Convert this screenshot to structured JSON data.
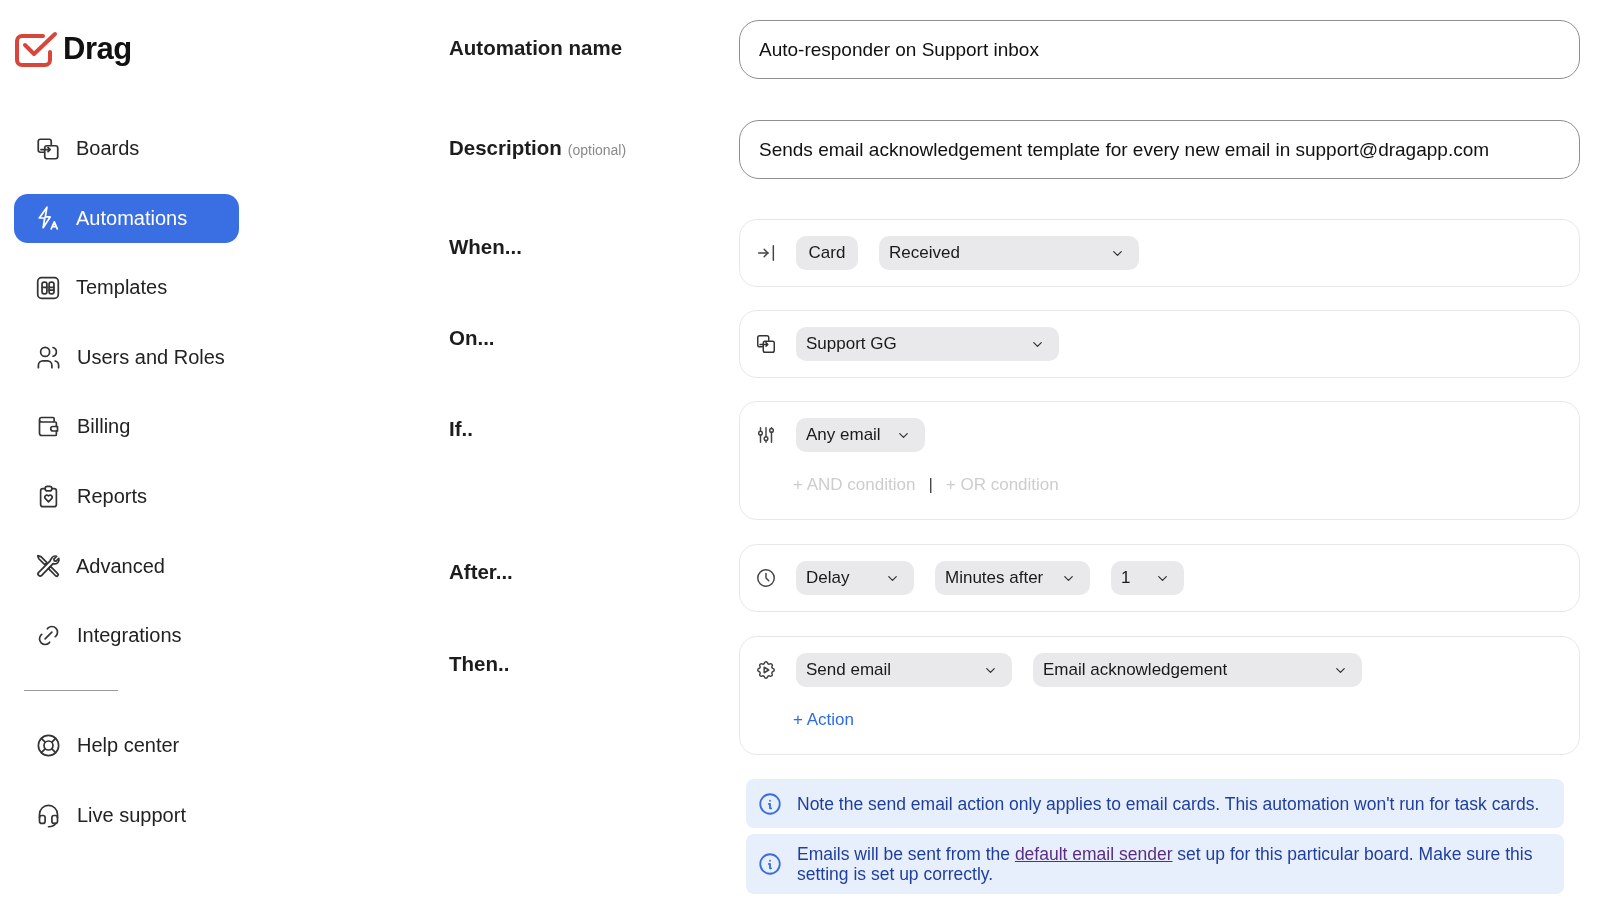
{
  "logo": {
    "text": "Drag"
  },
  "sidebar": {
    "items": [
      {
        "label": "Boards",
        "selected": false
      },
      {
        "label": "Automations",
        "selected": true
      },
      {
        "label": "Templates",
        "selected": false
      },
      {
        "label": "Users and Roles",
        "selected": false
      },
      {
        "label": "Billing",
        "selected": false
      },
      {
        "label": "Reports",
        "selected": false
      },
      {
        "label": "Advanced",
        "selected": false
      },
      {
        "label": "Integrations",
        "selected": false
      }
    ],
    "footer_items": [
      {
        "label": "Help center",
        "selected": false
      },
      {
        "label": "Live support",
        "selected": false
      }
    ]
  },
  "form": {
    "fields": [
      {
        "label": "Automation name",
        "value": "Auto-responder on Support inbox"
      },
      {
        "label": "Description",
        "hint": "(optional)",
        "value": "Sends email acknowledgement template for every new email in support@dragapp.com"
      }
    ],
    "steps": [
      {
        "label": "When...",
        "chips": [
          {
            "kind": "tag",
            "text": "Card"
          },
          {
            "kind": "dropdown",
            "text": "Received"
          }
        ]
      },
      {
        "label": "On...",
        "chips": [
          {
            "kind": "dropdown",
            "text": "Support GG"
          }
        ]
      },
      {
        "label": "If..",
        "chips": [
          {
            "kind": "dropdown",
            "text": "Any email"
          }
        ],
        "links": [
          {
            "text": "+ AND condition",
            "disabled": true
          },
          {
            "text": "+ OR condition",
            "disabled": true
          }
        ],
        "link_separator": "|"
      },
      {
        "label": "After...",
        "chips": [
          {
            "kind": "dropdown",
            "text": "Delay"
          },
          {
            "kind": "dropdown",
            "text": "Minutes after"
          },
          {
            "kind": "dropdown",
            "text": "1"
          }
        ]
      },
      {
        "label": "Then..",
        "chips": [
          {
            "kind": "dropdown",
            "text": "Send email"
          },
          {
            "kind": "dropdown",
            "text": "Email acknowledgement"
          }
        ],
        "links": [
          {
            "text": "+ Action",
            "disabled": false
          }
        ]
      }
    ]
  },
  "notes": [
    {
      "text": "Note the send email action only applies to email cards. This automation won't run for task cards."
    },
    {
      "text": "Emails will be sent from the",
      "link": "default email sender",
      "text_after": "set up for this particular board. Make sure this setting is set up correctly."
    }
  ]
}
